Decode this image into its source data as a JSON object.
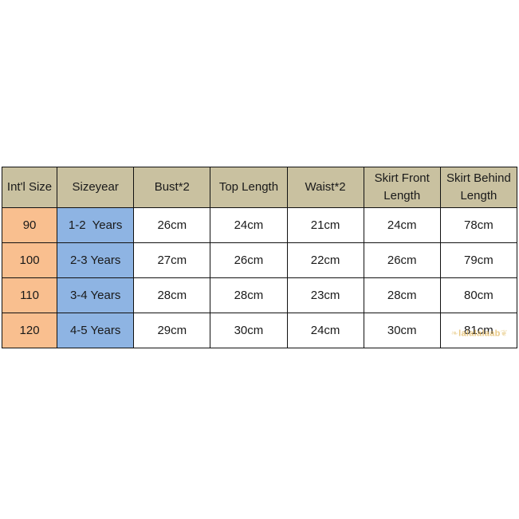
{
  "table": {
    "headers": [
      "Int'l Size",
      "Sizeyear",
      "Bust*2",
      "Top Length",
      "Waist*2",
      "Skirt Front Length",
      "Skirt Behind Length"
    ],
    "header_lines": [
      [
        "Int'l Size"
      ],
      [
        "Sizeyear"
      ],
      [
        "Bust*2"
      ],
      [
        "Top Length"
      ],
      [
        "Waist*2"
      ],
      [
        "Skirt Front",
        "Length"
      ],
      [
        "Skirt Behind",
        "Length"
      ]
    ],
    "rows": [
      [
        "90",
        "1-2  Years",
        "26cm",
        "24cm",
        "21cm",
        "24cm",
        "78cm"
      ],
      [
        "100",
        "2-3 Years",
        "27cm",
        "26cm",
        "22cm",
        "26cm",
        "79cm"
      ],
      [
        "110",
        "3-4 Years",
        "28cm",
        "28cm",
        "23cm",
        "28cm",
        "80cm"
      ],
      [
        "120",
        "4-5 Years",
        "29cm",
        "30cm",
        "24cm",
        "30cm",
        "81cm"
      ]
    ]
  },
  "colors": {
    "header_bg": "#c9c1a0",
    "intl_size_bg": "#f9bf8f",
    "sizeyear_bg": "#8eb4e3",
    "border": "#111111",
    "watermark": "#e2b75d"
  },
  "watermark": {
    "text": "lalalalaab",
    "left_wing": "❧",
    "right_wing": "❦"
  }
}
